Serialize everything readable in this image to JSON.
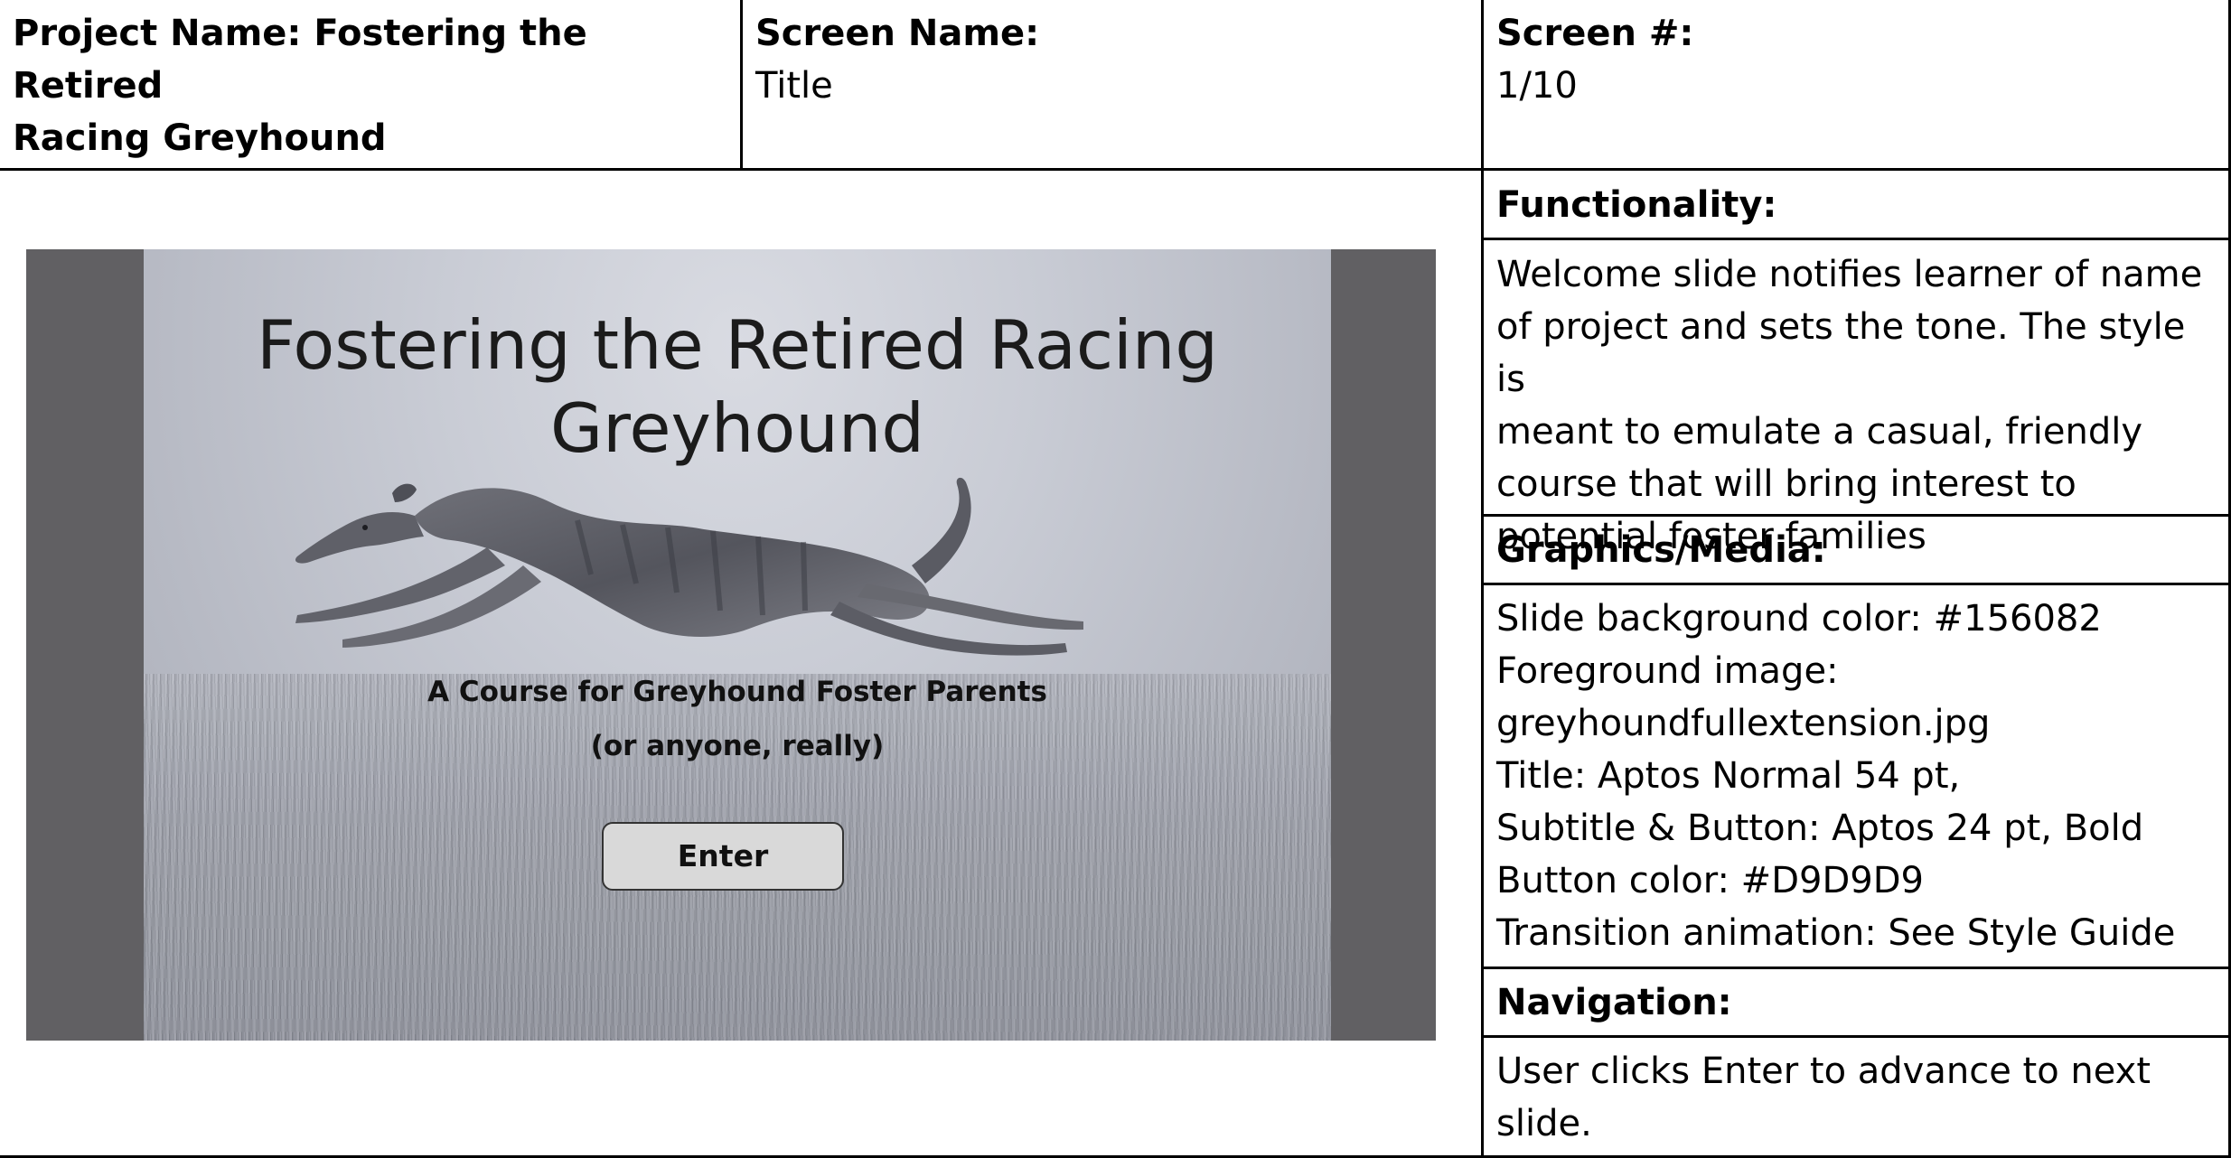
{
  "header": {
    "project_label": "Project Name: Fostering the Retired",
    "project_label_line2": "Racing Greyhound",
    "screen_name_label": "Screen Name:",
    "screen_name_value": "Title",
    "screen_num_label": "Screen #:",
    "screen_num_value": "1/10"
  },
  "functionality": {
    "heading": "Functionality:",
    "lines": [
      "Welcome slide notifies learner of name",
      "of project and sets the tone. The style is",
      "meant to emulate a casual, friendly",
      "course that will bring interest to",
      "potential foster families"
    ]
  },
  "graphics": {
    "heading": "Graphics/Media:",
    "lines": [
      "Slide background color: #156082",
      "Foreground image:",
      "greyhoundfullextension.jpg",
      "Title: Aptos Normal 54 pt,",
      "Subtitle & Button: Aptos 24 pt, Bold",
      "Button color: #D9D9D9",
      "Transition animation: See Style Guide"
    ]
  },
  "navigation": {
    "heading": "Navigation:",
    "lines": [
      "User clicks Enter to advance to next",
      "slide."
    ]
  },
  "slide": {
    "title_lines": [
      "Fostering the Retired Racing",
      "Greyhound"
    ],
    "subtitle_lines": [
      "A Course for Greyhound Foster Parents",
      "(or anyone, really)"
    ],
    "button_label": "Enter",
    "frame_color": "#616063",
    "button_color": "#D9D9D9"
  }
}
